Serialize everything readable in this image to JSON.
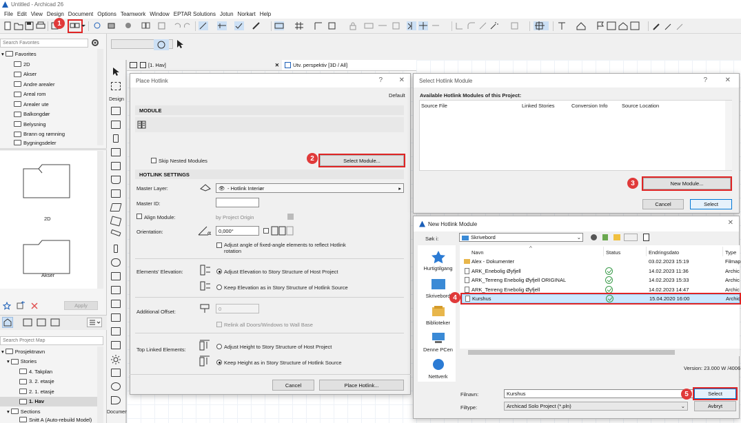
{
  "window": {
    "title": "Untitled - Archicad 26"
  },
  "menu": [
    "File",
    "Edit",
    "View",
    "Design",
    "Document",
    "Options",
    "Teamwork",
    "Window",
    "EPTAR Solutions",
    "Jotun",
    "Norkart",
    "Help"
  ],
  "navigator": {
    "search_favorites_placeholder": "Search Favorites",
    "favorites_label": "Favorites",
    "favorites": [
      "2D",
      "Akser",
      "Andre arealer",
      "Areal rom",
      "Arealer ute",
      "Balkongdør",
      "Belysning",
      "Brann og rømning",
      "Bygningsdeler"
    ],
    "preview_items": [
      "2D",
      "Akser"
    ],
    "apply_label": "Apply",
    "search_project_map_placeholder": "Search Project Map",
    "project_map": [
      {
        "label": "Prosjektnavn",
        "level": 0
      },
      {
        "label": "Stories",
        "level": 1
      },
      {
        "label": "4. Takplan",
        "level": 2
      },
      {
        "label": "3. 2. etasje",
        "level": 2
      },
      {
        "label": "2. 1. etasje",
        "level": 2
      },
      {
        "label": "1. Hav",
        "level": 2,
        "selected": true
      },
      {
        "label": "Sections",
        "level": 1
      },
      {
        "label": "Snitt A (Auto-rebuild Model)",
        "level": 2
      }
    ]
  },
  "toolbox": {
    "design_label": "Design",
    "document_label": "Documen"
  },
  "tabs": {
    "plan": "[1. Hav]",
    "view3d": "Utv. perspektiv [3D / All]"
  },
  "place_hotlink": {
    "title": "Place Hotlink",
    "help": "?",
    "default": "Default",
    "module_header": "MODULE",
    "skip_nested": "Skip Nested Modules",
    "select_module": "Select Module...",
    "hotlink_settings_header": "HOTLINK SETTINGS",
    "master_layer_label": "Master Layer:",
    "master_layer_value": "- Hotlink Interiør",
    "master_id_label": "Master ID:",
    "align_module": "Align Module:",
    "align_by": "by Project Origin",
    "orientation_label": "Orientation:",
    "orientation_value": "0,000°",
    "adjust_angle": "Adjust angle of fixed-angle elements to reflect Hotlink rotation",
    "elevation_label": "Elements' Elevation:",
    "elev_opt1": "Adjust Elevation to Story Structure of Host Project",
    "elev_opt2": "Keep Elevation as in Story Structure of Hotlink Source",
    "offset_label": "Additional Offset:",
    "offset_value": "0",
    "relink": "Relink all Doors/Windows to Wall Base",
    "top_linked_label": "Top Linked Elements:",
    "top_opt1": "Adjust Height to Story Structure of Host Project",
    "top_opt2": "Keep Height as in Story Structure of Hotlink Source",
    "cancel": "Cancel",
    "place": "Place Hotlink..."
  },
  "select_hotlink": {
    "title": "Select Hotlink Module",
    "help": "?",
    "available_label": "Available Hotlink Modules of this Project:",
    "columns": [
      "Source File",
      "Linked Stories",
      "Conversion Info",
      "Source Location"
    ],
    "new_module": "New Module...",
    "cancel": "Cancel",
    "select": "Select"
  },
  "new_hotlink": {
    "title": "New Hotlink Module",
    "search_in_label": "Søk i:",
    "search_in_value": "Skrivebord",
    "columns": [
      "Navn",
      "Status",
      "Endringsdato",
      "Type"
    ],
    "places": [
      "Hurtigtilgang",
      "Skrivebord",
      "Biblioteker",
      "Denne PCen",
      "Nettverk"
    ],
    "files": [
      {
        "name": "Alex - Dokumenter",
        "status": "",
        "date": "03.02.2023 15:19",
        "type": "Filmap",
        "folder": true
      },
      {
        "name": "ARK_Enebolig Øyfjell",
        "status": "ok",
        "date": "14.02.2023 11:36",
        "type": "Archic"
      },
      {
        "name": "ARK_Terreng Enebolig Øyfjell ORIGINAL",
        "status": "ok",
        "date": "14.02.2023 15:33",
        "type": "Archic"
      },
      {
        "name": "ARK_Terreng Enebolig Øyfjell",
        "status": "ok",
        "date": "14.02.2023 14:47",
        "type": "Archic"
      },
      {
        "name": "Kurshus",
        "status": "ok",
        "date": "15.04.2020 16:00",
        "type": "Archic",
        "selected": true
      }
    ],
    "version": "Version: 23.000 W /4006",
    "filename_label": "Filnavn:",
    "filename_value": "Kurshus",
    "filetype_label": "Filtype:",
    "filetype_value": "Archicad Solo Project (*.pln)",
    "select": "Select",
    "cancel": "Avbryt"
  },
  "badges": [
    "1",
    "2",
    "3",
    "4",
    "5"
  ],
  "colors": {
    "highlight": "#e02424",
    "accent": "#0078d7",
    "status_ok": "#3a9b4a"
  }
}
